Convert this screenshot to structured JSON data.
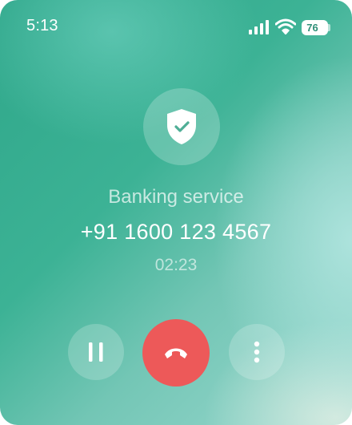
{
  "status_bar": {
    "time": "5:13",
    "battery_level": "76",
    "icons": [
      "signal-icon",
      "wifi-icon",
      "battery-icon"
    ]
  },
  "call": {
    "caller_name": "Banking service",
    "caller_number": "+91 1600 123 4567",
    "duration": "02:23",
    "verified_icon": "shield-check-icon"
  },
  "controls": [
    {
      "name": "hold",
      "icon": "pause-icon"
    },
    {
      "name": "end-call",
      "icon": "phone-hangup-icon",
      "color": "#ed5959"
    },
    {
      "name": "more-options",
      "icon": "more-vertical-icon"
    }
  ]
}
